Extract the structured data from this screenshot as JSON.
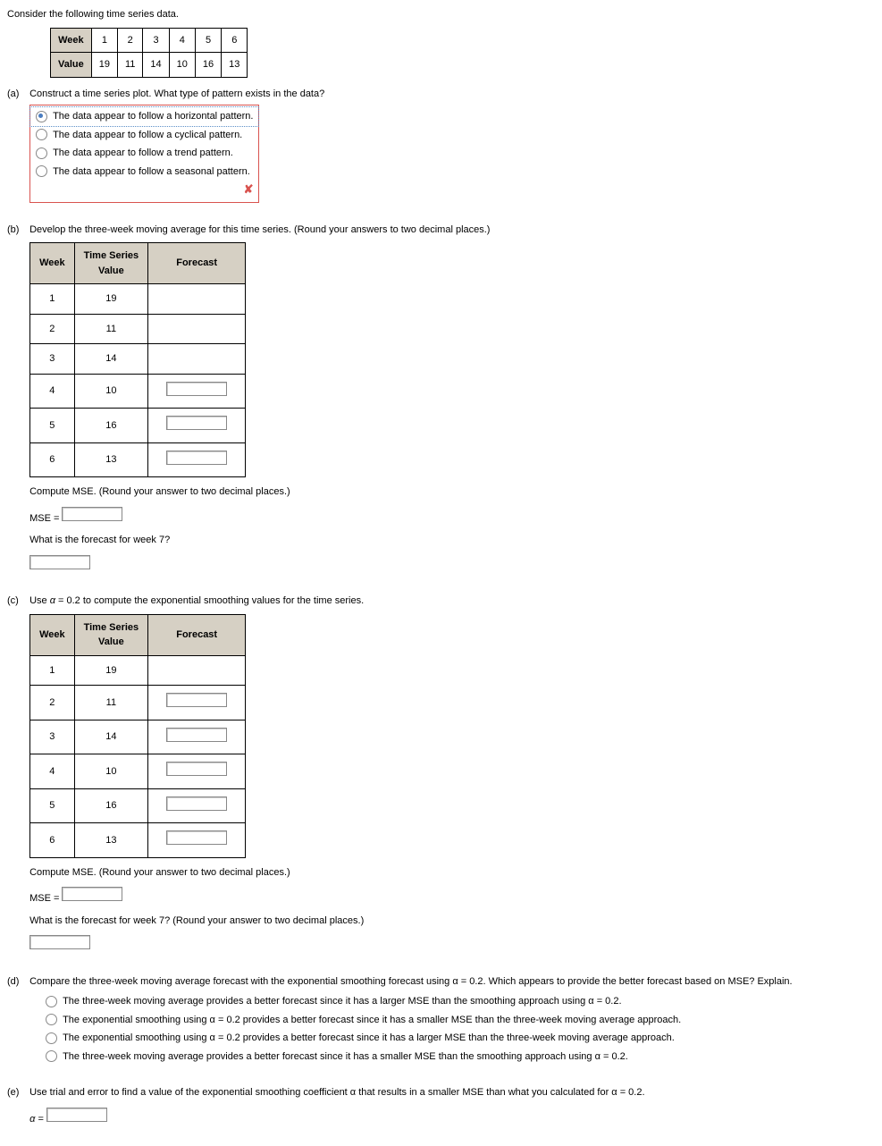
{
  "intro": "Consider the following time series data.",
  "data_table": {
    "row1_label": "Week",
    "row2_label": "Value",
    "weeks": [
      "1",
      "2",
      "3",
      "4",
      "5",
      "6"
    ],
    "values": [
      "19",
      "11",
      "14",
      "10",
      "16",
      "13"
    ]
  },
  "parts": {
    "a": {
      "label": "(a)",
      "prompt": "Construct a time series plot. What type of pattern exists in the data?",
      "options": [
        "The data appear to follow a horizontal pattern.",
        "The data appear to follow a cyclical pattern.",
        "The data appear to follow a trend pattern.",
        "The data appear to follow a seasonal pattern."
      ],
      "selected": 0
    },
    "b": {
      "label": "(b)",
      "prompt": "Develop the three-week moving average for this time series. (Round your answers to two decimal places.)",
      "headers": [
        "Week",
        "Time Series\nValue",
        "Forecast"
      ],
      "rows": [
        {
          "w": "1",
          "v": "19",
          "f": null
        },
        {
          "w": "2",
          "v": "11",
          "f": null
        },
        {
          "w": "3",
          "v": "14",
          "f": null
        },
        {
          "w": "4",
          "v": "10",
          "f": ""
        },
        {
          "w": "5",
          "v": "16",
          "f": ""
        },
        {
          "w": "6",
          "v": "13",
          "f": ""
        }
      ],
      "mse_prompt": "Compute MSE. (Round your answer to two decimal places.)",
      "mse_label": "MSE =",
      "q2": "What is the forecast for week 7?"
    },
    "c": {
      "label": "(c)",
      "prompt_before": "Use ",
      "prompt_alpha": "α",
      "prompt_after": " = 0.2 to compute the exponential smoothing values for the time series.",
      "headers": [
        "Week",
        "Time Series\nValue",
        "Forecast"
      ],
      "rows": [
        {
          "w": "1",
          "v": "19",
          "f": null
        },
        {
          "w": "2",
          "v": "11",
          "f": ""
        },
        {
          "w": "3",
          "v": "14",
          "f": ""
        },
        {
          "w": "4",
          "v": "10",
          "f": ""
        },
        {
          "w": "5",
          "v": "16",
          "f": ""
        },
        {
          "w": "6",
          "v": "13",
          "f": ""
        }
      ],
      "mse_prompt": "Compute MSE. (Round your answer to two decimal places.)",
      "mse_label": "MSE =",
      "q2": "What is the forecast for week 7? (Round your answer to two decimal places.)"
    },
    "d": {
      "label": "(d)",
      "prompt": "Compare the three-week moving average forecast with the exponential smoothing forecast using α = 0.2. Which appears to provide the better forecast based on MSE? Explain.",
      "options": [
        "The three-week moving average provides a better forecast since it has a larger MSE than the smoothing approach using α = 0.2.",
        "The exponential smoothing using α = 0.2 provides a better forecast since it has a smaller MSE than the three-week moving average approach.",
        "The exponential smoothing using α = 0.2 provides a better forecast since it has a larger MSE than the three-week moving average approach.",
        "The three-week moving average provides a better forecast since it has a smaller MSE than the smoothing approach using α = 0.2."
      ]
    },
    "e": {
      "label": "(e)",
      "prompt": "Use trial and error to find a value of the exponential smoothing coefficient α that results in a smaller MSE than what you calculated for α = 0.2.",
      "alpha_label": "α ="
    }
  }
}
